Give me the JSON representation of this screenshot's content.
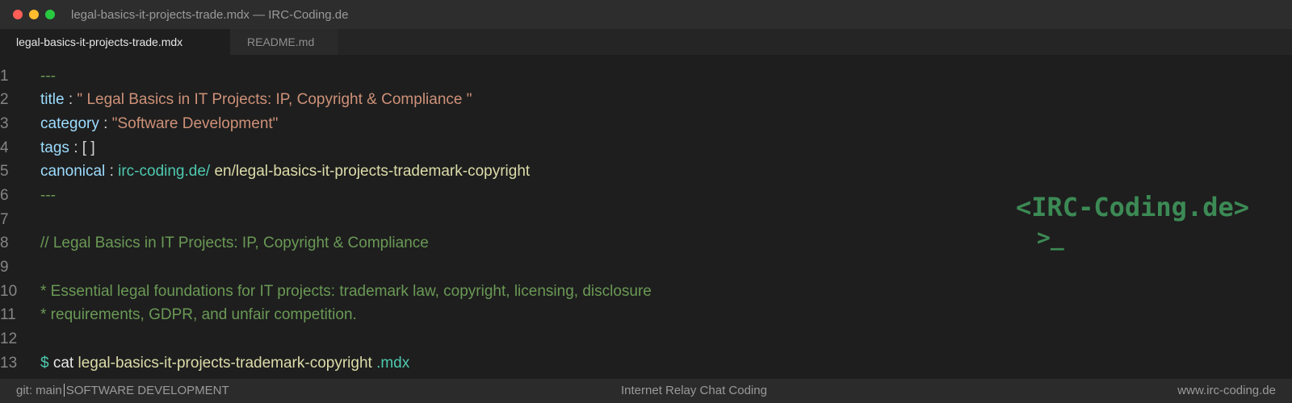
{
  "window": {
    "title": "legal-basics-it-projects-trade.mdx — IRC-Coding.de"
  },
  "tabs": [
    {
      "label": "legal-basics-it-projects-trade.mdx",
      "active": true
    },
    {
      "label": "README.md",
      "active": false
    }
  ],
  "editor": {
    "line_numbers": [
      "1",
      "2",
      "3",
      "4",
      "5",
      "6",
      "7",
      "8",
      "9",
      "10",
      "11",
      "12",
      "13"
    ],
    "frontmatter_open": "---",
    "title_key": "title",
    "title_value": "\" Legal Basics in IT Projects: IP, Copyright & Compliance \"",
    "category_key": "category",
    "category_value": "\"Software Development\"",
    "tags_key": "tags",
    "tags_value": "[ ]",
    "canonical_key": "canonical",
    "canonical_domain": "irc-coding.de/",
    "canonical_path": "en/legal-basics-it-projects-trademark-copyright",
    "frontmatter_close": "---",
    "separator": ":",
    "heading_comment": "// Legal Basics in IT Projects: IP, Copyright & Compliance",
    "desc_line1": "* Essential legal foundations for IT projects: trademark law, copyright, licensing, disclosure",
    "desc_line2": "* requirements, GDPR, and unfair competition.",
    "prompt_symbol": "$",
    "command": "cat",
    "command_file": "legal-basics-it-projects-trademark-copyright",
    "command_ext": ".mdx"
  },
  "logo": {
    "text": "<IRC-Coding.de>",
    "prompt": ">_"
  },
  "statusbar": {
    "branch": "git: main",
    "category": "SOFTWARE DEVELOPMENT",
    "center": "Internet Relay Chat Coding",
    "right": "www.irc-coding.de"
  },
  "colors": {
    "background": "#1e1e1e",
    "key": "#9cdcfe",
    "string": "#ce9178",
    "comment": "#6a9955",
    "link": "#4ec9b0",
    "path": "#dcdcaa",
    "logo": "#3c8a55"
  }
}
